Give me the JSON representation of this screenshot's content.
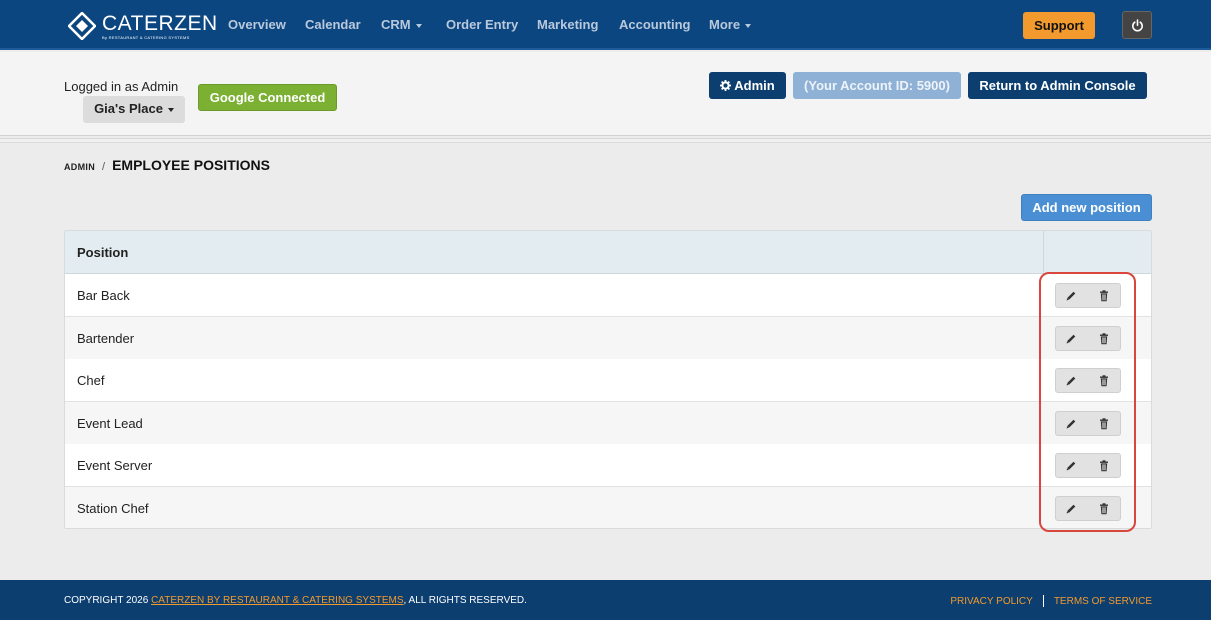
{
  "app": {
    "logo_text": "CATERZEN",
    "logo_sub": "By RESTAURANT & CATERING SYSTEMS"
  },
  "nav": {
    "overview": "Overview",
    "calendar": "Calendar",
    "crm": "CRM",
    "order_entry": "Order Entry",
    "marketing": "Marketing",
    "accounting": "Accounting",
    "more": "More",
    "support": "Support"
  },
  "header": {
    "logged_in": "Logged in as Admin",
    "account_name": "Gia's Place",
    "google": "Google Connected",
    "admin_btn": "Admin",
    "account_id": "(Your Account ID: 5900)",
    "return_btn": "Return to Admin Console"
  },
  "breadcrumb": {
    "parent": "ADMIN",
    "sep": "/",
    "title": "EMPLOYEE POSITIONS"
  },
  "add_button": "Add new position",
  "table": {
    "header": "Position",
    "rows": [
      {
        "name": "Bar Back"
      },
      {
        "name": "Bartender"
      },
      {
        "name": "Chef"
      },
      {
        "name": "Event Lead"
      },
      {
        "name": "Event Server"
      },
      {
        "name": "Station Chef"
      }
    ]
  },
  "footer": {
    "copyright_prefix": "COPYRIGHT 2026",
    "copyright_link": "CATERZEN BY RESTAURANT & CATERING SYSTEMS",
    "copyright_suffix": ", ALL RIGHTS RESERVED.",
    "privacy": "PRIVACY POLICY",
    "terms": "TERMS OF SERVICE"
  },
  "colors": {
    "nav_bg": "#0c4680",
    "accent": "#f29a2e",
    "google": "#7bb032",
    "primary": "#4a8fd4",
    "highlight": "#d8463c"
  },
  "icons": {
    "edit": "pencil-icon",
    "delete": "trash-icon",
    "power": "power-icon",
    "admin": "gear-icon"
  }
}
